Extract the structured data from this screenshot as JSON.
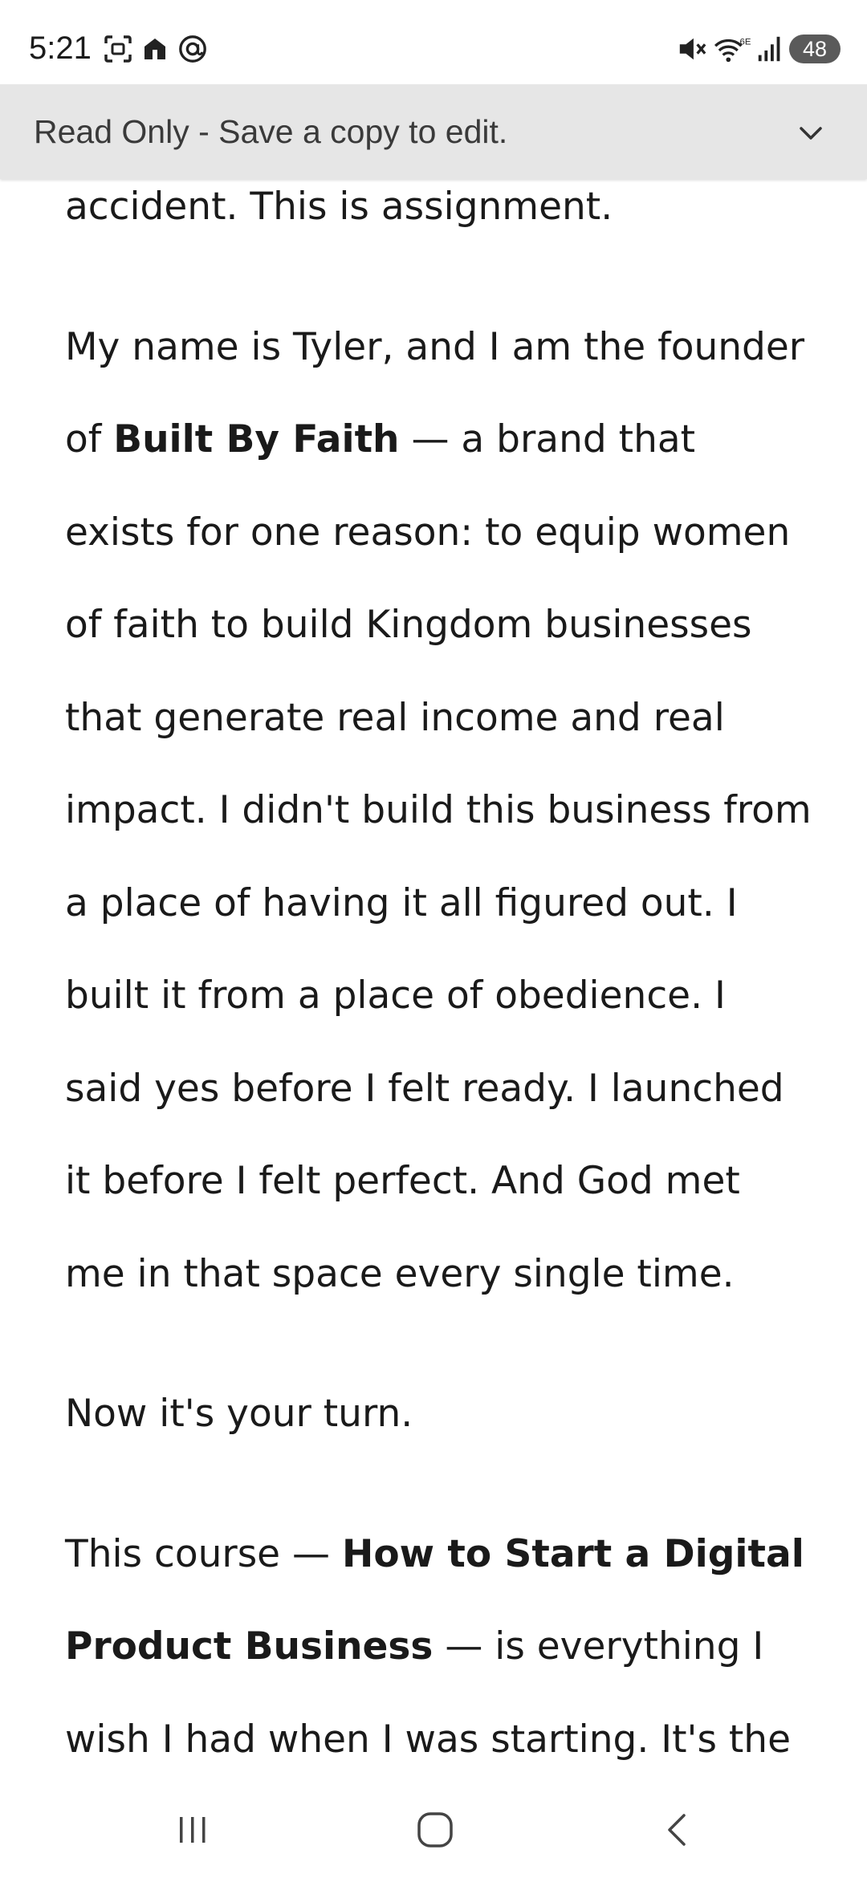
{
  "status_bar": {
    "time": "5:21",
    "battery": "48",
    "icons": [
      "screenshot-icon",
      "home-alert-icon",
      "threads-icon",
      "mute-icon",
      "wifi-6e-icon",
      "signal-icon"
    ]
  },
  "banner": {
    "text": "Read Only - Save a copy to edit.",
    "chevron_icon": "chevron-down-icon"
  },
  "document": {
    "p0": "accident. This is assignment.",
    "p1": {
      "pre": "My name is Tyler, and I am the founder of ",
      "bold": "Built By Faith",
      "post": " — a brand that exists for one reason: to equip women of faith to build Kingdom businesses that generate real income and real impact. I didn't build this business from a place of having it all figured out. I built it from a place of obedience. I said yes before I felt ready. I launched it before I felt perfect. And God met me in that space every single time."
    },
    "p2": "Now it's your turn.",
    "p3": {
      "pre": "This course — ",
      "bold": "How to Start a Digital Product Business",
      "post": " — is everything I wish I had when I was starting. It's the"
    }
  },
  "nav_bar": {
    "recents_icon": "recent-apps-icon",
    "home_icon": "home-icon",
    "back_icon": "back-icon"
  }
}
